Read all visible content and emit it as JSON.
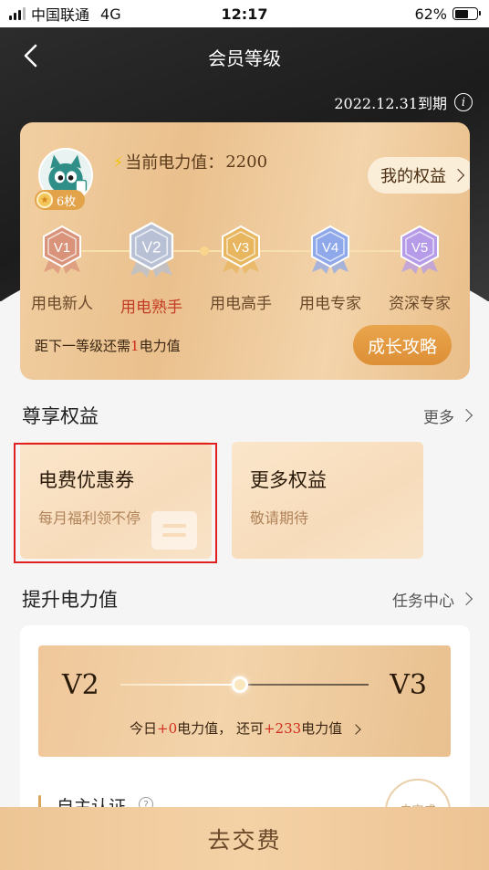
{
  "status_bar": {
    "carrier": "中国联通",
    "network": "4G",
    "time": "12:17",
    "battery": "62%",
    "battery_level": 0.62
  },
  "nav": {
    "title": "会员等级"
  },
  "card": {
    "expire": "2022.12.31到期",
    "badge_count": "6枚",
    "power_label": "当前电力值：",
    "power_value": "2200",
    "my_rights": "我的权益",
    "levels": [
      {
        "code": "V1",
        "label": "用电新人",
        "color": "#d9937a"
      },
      {
        "code": "V2",
        "label": "用电熟手",
        "color": "#b7c0d4",
        "active": true
      },
      {
        "code": "V3",
        "label": "用电高手",
        "color": "#e8b65e"
      },
      {
        "code": "V4",
        "label": "用电专家",
        "color": "#8fa8ea"
      },
      {
        "code": "V5",
        "label": "资深专家",
        "color": "#b59be8"
      }
    ],
    "next_prefix": "距下一等级还需",
    "next_value": "1",
    "next_suffix": "电力值",
    "strategy": "成长攻略"
  },
  "benefits": {
    "title": "尊享权益",
    "more": "更多",
    "items": [
      {
        "title": "电费优惠券",
        "subtitle": "每月福利领不停"
      },
      {
        "title": "更多权益",
        "subtitle": "敬请期待"
      }
    ]
  },
  "power": {
    "title": "提升电力值",
    "task_center": "任务中心",
    "from": "V2",
    "to": "V3",
    "today_prefix": "今日",
    "today_value": "+0",
    "today_mid": "电力值，  还可",
    "remain_value": "+233",
    "remain_suffix": "电力值",
    "task_name": "自主认证",
    "task_help": "?",
    "task_button": "去完成"
  },
  "bottom": {
    "pay": "去交费"
  }
}
